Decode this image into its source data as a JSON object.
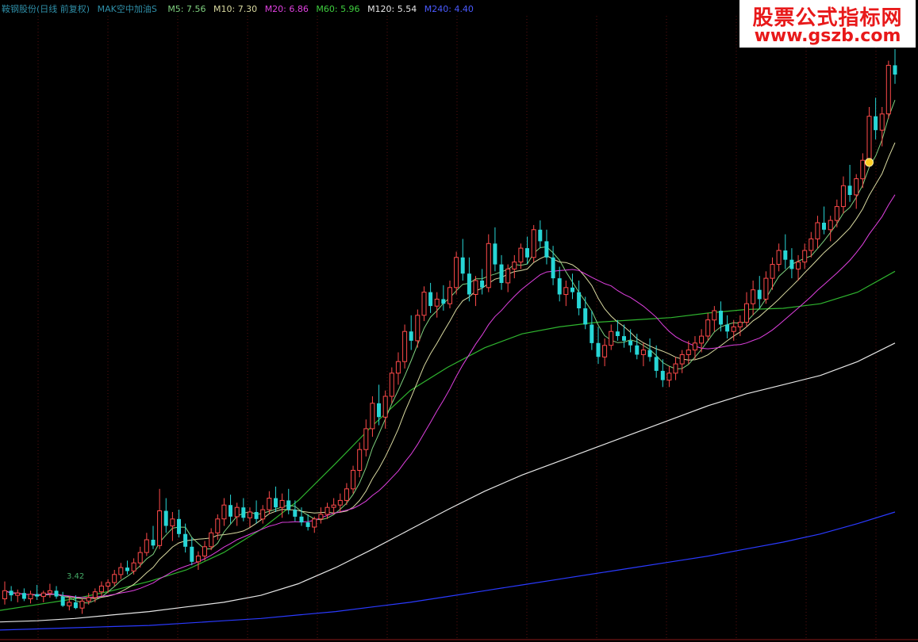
{
  "header": {
    "stock_name": "鞍钢股份(日线 前复权)",
    "indicator": "MAK空中加油S",
    "ma_values": [
      {
        "label": "M5: 7.56",
        "color": "#7fd07f"
      },
      {
        "label": "M10: 7.30",
        "color": "#d9d9a0"
      },
      {
        "label": "M20: 6.86",
        "color": "#e040e0"
      },
      {
        "label": "M60: 5.96",
        "color": "#3fcf3f"
      },
      {
        "label": "M120: 5.54",
        "color": "#e6e6e6"
      },
      {
        "label": "M240: 4.40",
        "color": "#2a3aff"
      }
    ]
  },
  "watermark": {
    "line1": "股票公式指标网",
    "line2": "www.gszb.com"
  },
  "min_price_label": "3.42",
  "colors": {
    "up": "#ff4a4a",
    "down": "#27d6d6",
    "background": "#000000",
    "grid": "#5a1010"
  },
  "chart_data": {
    "type": "candlestick",
    "title": "",
    "ylim": [
      3.3,
      8.3
    ],
    "grid": true,
    "ohlc": [
      [
        3.55,
        3.7,
        3.5,
        3.62
      ],
      [
        3.62,
        3.66,
        3.53,
        3.58
      ],
      [
        3.58,
        3.63,
        3.52,
        3.6
      ],
      [
        3.6,
        3.64,
        3.53,
        3.55
      ],
      [
        3.55,
        3.62,
        3.51,
        3.59
      ],
      [
        3.59,
        3.67,
        3.54,
        3.57
      ],
      [
        3.57,
        3.62,
        3.52,
        3.6
      ],
      [
        3.6,
        3.68,
        3.56,
        3.62
      ],
      [
        3.62,
        3.66,
        3.55,
        3.57
      ],
      [
        3.57,
        3.61,
        3.48,
        3.49
      ],
      [
        3.49,
        3.57,
        3.45,
        3.52
      ],
      [
        3.52,
        3.58,
        3.46,
        3.47
      ],
      [
        3.47,
        3.55,
        3.42,
        3.53
      ],
      [
        3.53,
        3.6,
        3.5,
        3.56
      ],
      [
        3.56,
        3.64,
        3.52,
        3.61
      ],
      [
        3.61,
        3.7,
        3.57,
        3.66
      ],
      [
        3.66,
        3.72,
        3.6,
        3.69
      ],
      [
        3.69,
        3.8,
        3.66,
        3.76
      ],
      [
        3.76,
        3.86,
        3.72,
        3.82
      ],
      [
        3.82,
        3.88,
        3.76,
        3.79
      ],
      [
        3.79,
        3.9,
        3.76,
        3.86
      ],
      [
        3.86,
        4.0,
        3.82,
        3.95
      ],
      [
        3.95,
        4.12,
        3.92,
        4.06
      ],
      [
        4.06,
        4.18,
        3.98,
        4.01
      ],
      [
        4.01,
        4.5,
        3.98,
        4.31
      ],
      [
        4.31,
        4.42,
        4.12,
        4.18
      ],
      [
        4.18,
        4.3,
        4.05,
        4.24
      ],
      [
        4.24,
        4.32,
        4.08,
        4.11
      ],
      [
        4.11,
        4.2,
        3.95,
        4.0
      ],
      [
        4.0,
        4.08,
        3.84,
        3.87
      ],
      [
        3.87,
        3.96,
        3.8,
        3.92
      ],
      [
        3.92,
        4.05,
        3.88,
        4.0
      ],
      [
        4.0,
        4.16,
        3.97,
        4.12
      ],
      [
        4.12,
        4.28,
        4.06,
        4.24
      ],
      [
        4.24,
        4.42,
        4.18,
        4.36
      ],
      [
        4.36,
        4.45,
        4.2,
        4.26
      ],
      [
        4.26,
        4.38,
        4.18,
        4.34
      ],
      [
        4.34,
        4.42,
        4.22,
        4.25
      ],
      [
        4.25,
        4.34,
        4.17,
        4.3
      ],
      [
        4.3,
        4.4,
        4.2,
        4.24
      ],
      [
        4.24,
        4.36,
        4.2,
        4.32
      ],
      [
        4.32,
        4.48,
        4.28,
        4.42
      ],
      [
        4.42,
        4.52,
        4.3,
        4.34
      ],
      [
        4.34,
        4.46,
        4.25,
        4.4
      ],
      [
        4.4,
        4.5,
        4.28,
        4.32
      ],
      [
        4.32,
        4.4,
        4.22,
        4.26
      ],
      [
        4.26,
        4.34,
        4.18,
        4.21
      ],
      [
        4.21,
        4.28,
        4.14,
        4.17
      ],
      [
        4.17,
        4.26,
        4.12,
        4.24
      ],
      [
        4.24,
        4.34,
        4.2,
        4.28
      ],
      [
        4.28,
        4.38,
        4.24,
        4.34
      ],
      [
        4.34,
        4.42,
        4.28,
        4.36
      ],
      [
        4.36,
        4.46,
        4.3,
        4.4
      ],
      [
        4.4,
        4.55,
        4.36,
        4.5
      ],
      [
        4.5,
        4.7,
        4.46,
        4.66
      ],
      [
        4.66,
        4.9,
        4.6,
        4.84
      ],
      [
        4.84,
        5.1,
        4.78,
        5.02
      ],
      [
        5.02,
        5.3,
        4.95,
        5.24
      ],
      [
        5.24,
        5.4,
        5.05,
        5.12
      ],
      [
        5.12,
        5.35,
        5.02,
        5.3
      ],
      [
        5.3,
        5.55,
        5.24,
        5.5
      ],
      [
        5.5,
        5.68,
        5.4,
        5.6
      ],
      [
        5.6,
        5.92,
        5.54,
        5.86
      ],
      [
        5.86,
        6.0,
        5.7,
        5.78
      ],
      [
        5.78,
        6.05,
        5.72,
        6.0
      ],
      [
        6.0,
        6.25,
        5.95,
        6.2
      ],
      [
        6.2,
        6.28,
        6.02,
        6.08
      ],
      [
        6.08,
        6.2,
        5.98,
        6.14
      ],
      [
        6.14,
        6.26,
        6.04,
        6.1
      ],
      [
        6.1,
        6.3,
        6.06,
        6.24
      ],
      [
        6.24,
        6.55,
        6.18,
        6.5
      ],
      [
        6.5,
        6.66,
        6.3,
        6.36
      ],
      [
        6.36,
        6.5,
        6.12,
        6.18
      ],
      [
        6.18,
        6.34,
        6.08,
        6.3
      ],
      [
        6.3,
        6.4,
        6.18,
        6.24
      ],
      [
        6.24,
        6.7,
        6.2,
        6.62
      ],
      [
        6.62,
        6.76,
        6.38,
        6.44
      ],
      [
        6.44,
        6.52,
        6.22,
        6.28
      ],
      [
        6.28,
        6.44,
        6.2,
        6.4
      ],
      [
        6.4,
        6.52,
        6.32,
        6.46
      ],
      [
        6.46,
        6.62,
        6.4,
        6.58
      ],
      [
        6.58,
        6.68,
        6.44,
        6.5
      ],
      [
        6.5,
        6.78,
        6.46,
        6.74
      ],
      [
        6.74,
        6.82,
        6.58,
        6.64
      ],
      [
        6.64,
        6.74,
        6.44,
        6.5
      ],
      [
        6.5,
        6.6,
        6.26,
        6.32
      ],
      [
        6.32,
        6.42,
        6.12,
        6.18
      ],
      [
        6.18,
        6.3,
        6.08,
        6.24
      ],
      [
        6.24,
        6.36,
        6.14,
        6.2
      ],
      [
        6.2,
        6.3,
        6.0,
        6.06
      ],
      [
        6.06,
        6.16,
        5.88,
        5.92
      ],
      [
        5.92,
        6.04,
        5.7,
        5.76
      ],
      [
        5.76,
        5.9,
        5.58,
        5.64
      ],
      [
        5.64,
        5.8,
        5.56,
        5.74
      ],
      [
        5.74,
        5.92,
        5.7,
        5.86
      ],
      [
        5.86,
        5.96,
        5.78,
        5.82
      ],
      [
        5.82,
        5.92,
        5.72,
        5.78
      ],
      [
        5.78,
        5.88,
        5.68,
        5.74
      ],
      [
        5.74,
        5.84,
        5.62,
        5.66
      ],
      [
        5.66,
        5.76,
        5.56,
        5.7
      ],
      [
        5.7,
        5.8,
        5.6,
        5.64
      ],
      [
        5.64,
        5.74,
        5.46,
        5.52
      ],
      [
        5.52,
        5.62,
        5.38,
        5.44
      ],
      [
        5.44,
        5.56,
        5.38,
        5.5
      ],
      [
        5.5,
        5.64,
        5.44,
        5.58
      ],
      [
        5.58,
        5.7,
        5.5,
        5.66
      ],
      [
        5.66,
        5.78,
        5.58,
        5.7
      ],
      [
        5.7,
        5.82,
        5.62,
        5.76
      ],
      [
        5.76,
        5.88,
        5.68,
        5.82
      ],
      [
        5.82,
        6.02,
        5.78,
        5.96
      ],
      [
        5.96,
        6.08,
        5.86,
        6.04
      ],
      [
        6.04,
        6.12,
        5.86,
        5.92
      ],
      [
        5.92,
        6.0,
        5.8,
        5.86
      ],
      [
        5.86,
        5.96,
        5.78,
        5.9
      ],
      [
        5.9,
        6.0,
        5.82,
        5.94
      ],
      [
        5.94,
        6.2,
        5.9,
        6.1
      ],
      [
        6.1,
        6.3,
        6.0,
        6.22
      ],
      [
        6.22,
        6.34,
        6.06,
        6.14
      ],
      [
        6.14,
        6.38,
        6.1,
        6.32
      ],
      [
        6.32,
        6.5,
        6.22,
        6.44
      ],
      [
        6.44,
        6.62,
        6.38,
        6.56
      ],
      [
        6.56,
        6.7,
        6.4,
        6.48
      ],
      [
        6.48,
        6.58,
        6.32,
        6.4
      ],
      [
        6.4,
        6.52,
        6.3,
        6.46
      ],
      [
        6.46,
        6.62,
        6.4,
        6.56
      ],
      [
        6.56,
        6.72,
        6.5,
        6.66
      ],
      [
        6.66,
        6.86,
        6.58,
        6.8
      ],
      [
        6.8,
        6.94,
        6.7,
        6.74
      ],
      [
        6.74,
        6.86,
        6.64,
        6.82
      ],
      [
        6.82,
        7.0,
        6.76,
        6.94
      ],
      [
        6.94,
        7.2,
        6.88,
        7.12
      ],
      [
        7.12,
        7.3,
        6.98,
        7.04
      ],
      [
        7.04,
        7.22,
        6.92,
        7.18
      ],
      [
        7.18,
        7.4,
        7.1,
        7.34
      ],
      [
        7.34,
        7.8,
        7.28,
        7.72
      ],
      [
        7.72,
        7.88,
        7.52,
        7.6
      ],
      [
        7.6,
        7.8,
        7.46,
        7.74
      ],
      [
        7.74,
        8.2,
        7.7,
        8.16
      ],
      [
        8.16,
        8.3,
        8.0,
        8.08
      ]
    ],
    "ma_periods": [
      5,
      10,
      20,
      60,
      120,
      240
    ],
    "long_ma_curves": {
      "M60": [
        3.45,
        3.5,
        3.55,
        3.62,
        3.7,
        3.8,
        3.95,
        4.15,
        4.4,
        4.72,
        5.05,
        5.35,
        5.55,
        5.72,
        5.84,
        5.9,
        5.94,
        5.96,
        5.98,
        6.02,
        6.05,
        6.06,
        6.1,
        6.2,
        6.38
      ],
      "M120": [
        3.35,
        3.36,
        3.38,
        3.41,
        3.44,
        3.48,
        3.52,
        3.58,
        3.68,
        3.82,
        3.98,
        4.15,
        4.32,
        4.48,
        4.62,
        4.74,
        4.86,
        4.98,
        5.1,
        5.22,
        5.32,
        5.4,
        5.48,
        5.6,
        5.76
      ],
      "M240": [
        3.28,
        3.29,
        3.3,
        3.31,
        3.32,
        3.34,
        3.36,
        3.38,
        3.41,
        3.44,
        3.48,
        3.52,
        3.57,
        3.62,
        3.67,
        3.72,
        3.77,
        3.82,
        3.87,
        3.92,
        3.98,
        4.04,
        4.11,
        4.2,
        4.3
      ]
    }
  }
}
